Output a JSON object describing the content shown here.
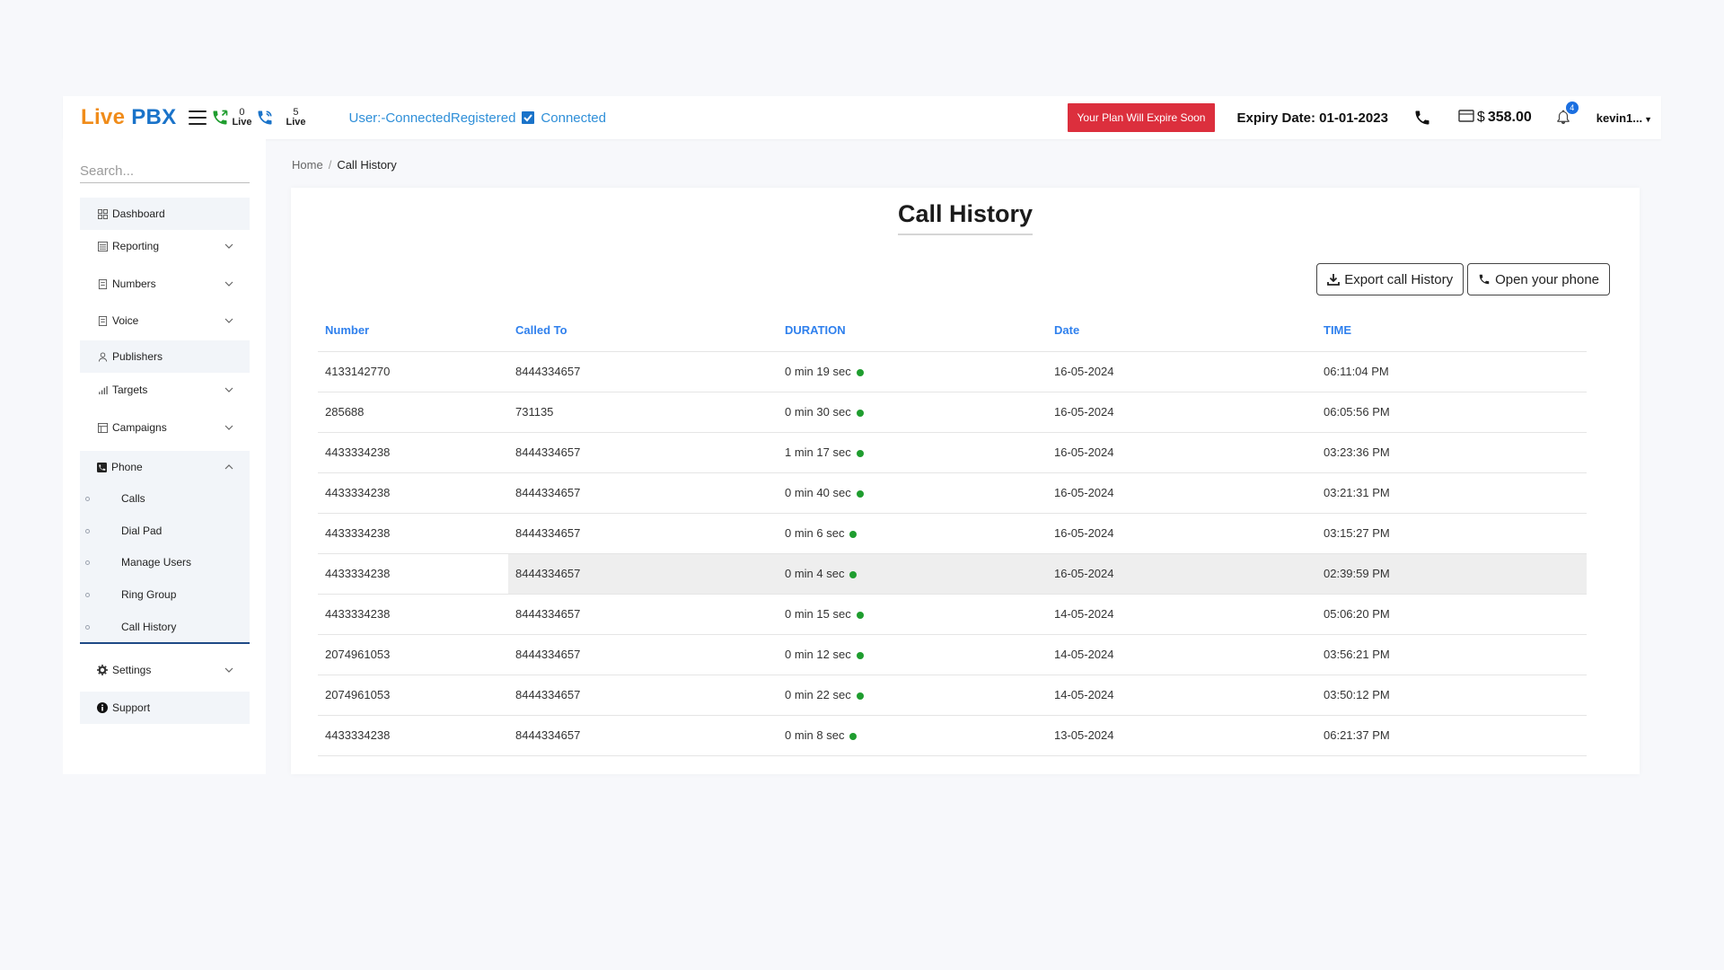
{
  "header": {
    "logo_part1": "Live",
    "logo_part2": "PBX",
    "live_left_count": "0",
    "live_left_label": "Live",
    "live_right_count": "5",
    "live_right_label": "Live",
    "user_status": "User:-ConnectedRegistered",
    "connection_status": "Connected",
    "plan_warning": "Your Plan Will Expire Soon",
    "expiry": "Expiry Date: 01-01-2023",
    "currency": "$",
    "balance": "358.00",
    "notification_count": "4",
    "username": "kevin1...",
    "colors": {
      "accent_orange": "#f08c1a",
      "accent_blue": "#1a73c9",
      "alert_red": "#dc2f3d",
      "link_blue": "#2f80ed",
      "status_green": "#1f9d2f"
    }
  },
  "sidebar": {
    "search_placeholder": "Search...",
    "items": [
      {
        "label": "Dashboard",
        "icon": "grid-icon"
      },
      {
        "label": "Reporting",
        "icon": "report-icon"
      },
      {
        "label": "Numbers",
        "icon": "document-icon"
      },
      {
        "label": "Voice",
        "icon": "document-icon"
      },
      {
        "label": "Publishers",
        "icon": "user-icon"
      },
      {
        "label": "Targets",
        "icon": "bar-chart-icon"
      },
      {
        "label": "Campaigns",
        "icon": "table-icon"
      },
      {
        "label": "Phone",
        "icon": "phone-square-icon"
      },
      {
        "label": "Settings",
        "icon": "gear-icon"
      },
      {
        "label": "Support",
        "icon": "info-icon"
      }
    ],
    "phone_submenu": [
      "Calls",
      "Dial Pad",
      "Manage Users",
      "Ring Group",
      "Call History"
    ]
  },
  "breadcrumb": {
    "home": "Home",
    "separator": "/",
    "current": "Call History"
  },
  "main": {
    "title": "Call History",
    "export_label": "Export call History",
    "open_phone_label": "Open your phone",
    "columns": [
      "Number",
      "Called To",
      "DURATION",
      "Date",
      "TIME"
    ],
    "rows": [
      {
        "number": "4133142770",
        "called_to": "8444334657",
        "duration": "0 min 19 sec",
        "date": "16-05-2024",
        "time": "06:11:04 PM"
      },
      {
        "number": "285688",
        "called_to": "731135",
        "duration": "0 min 30 sec",
        "date": "16-05-2024",
        "time": "06:05:56 PM"
      },
      {
        "number": "4433334238",
        "called_to": "8444334657",
        "duration": "1 min 17 sec",
        "date": "16-05-2024",
        "time": "03:23:36 PM"
      },
      {
        "number": "4433334238",
        "called_to": "8444334657",
        "duration": "0 min 40 sec",
        "date": "16-05-2024",
        "time": "03:21:31 PM"
      },
      {
        "number": "4433334238",
        "called_to": "8444334657",
        "duration": "0 min 6 sec",
        "date": "16-05-2024",
        "time": "03:15:27 PM"
      },
      {
        "number": "4433334238",
        "called_to": "8444334657",
        "duration": "0 min 4 sec",
        "date": "16-05-2024",
        "time": "02:39:59 PM"
      },
      {
        "number": "4433334238",
        "called_to": "8444334657",
        "duration": "0 min 15 sec",
        "date": "14-05-2024",
        "time": "05:06:20 PM"
      },
      {
        "number": "2074961053",
        "called_to": "8444334657",
        "duration": "0 min 12 sec",
        "date": "14-05-2024",
        "time": "03:56:21 PM"
      },
      {
        "number": "2074961053",
        "called_to": "8444334657",
        "duration": "0 min 22 sec",
        "date": "14-05-2024",
        "time": "03:50:12 PM"
      },
      {
        "number": "4433334238",
        "called_to": "8444334657",
        "duration": "0 min 8 sec",
        "date": "13-05-2024",
        "time": "06:21:37 PM"
      }
    ]
  }
}
